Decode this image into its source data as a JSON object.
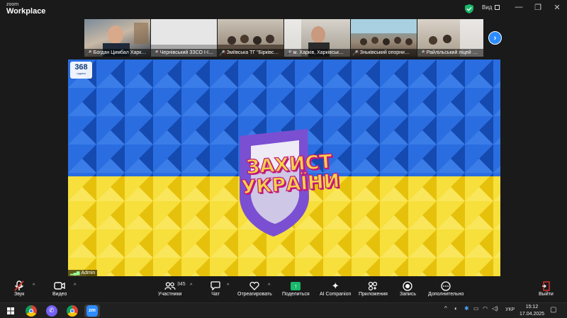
{
  "app": {
    "logo_top": "zoom",
    "logo_bottom": "Workplace",
    "view_label": "Вид",
    "window_controls": {
      "minimize": "—",
      "maximize": "❐",
      "close": "✕"
    }
  },
  "gallery": {
    "participants": [
      {
        "name": "Богдан Цимбал Харк…",
        "mic": "muted"
      },
      {
        "name": "Чернівський ЗЗСО І-І…",
        "mic": "muted"
      },
      {
        "name": "Зміївська ТГ \"Бірківс…",
        "mic": "muted"
      },
      {
        "name": "м. Харків, Харківськ…",
        "mic": "muted"
      },
      {
        "name": "Зньківський опорни…",
        "mic": "muted"
      },
      {
        "name": "Райлільський ліцей …",
        "mic": "muted"
      }
    ],
    "next_icon": "chevron-right-icon"
  },
  "main_share": {
    "badge_number": "368",
    "badge_sublabel": "години",
    "logo_line1": "ЗАХИСТ",
    "logo_line2": "УКРАЇНИ",
    "presenter_name": "Admin",
    "colors": {
      "blue": "#1f5fd1",
      "yellow": "#f3d21a",
      "shield": "#7b4fd1",
      "logo_text": "#f7d24a"
    }
  },
  "toolbar": {
    "audio_label": "Звук",
    "video_label": "Видео",
    "participants_label": "Участники",
    "participants_count": "345",
    "chat_label": "Чат",
    "react_label": "Отреагировать",
    "share_label": "Поделиться",
    "ai_label": "AI Companion",
    "apps_label": "Приложения",
    "record_label": "Запись",
    "more_label": "Дополнительно",
    "leave_label": "Выйти"
  },
  "taskbar": {
    "language": "УКР",
    "time": "15:12",
    "date": "17.04.2025"
  }
}
